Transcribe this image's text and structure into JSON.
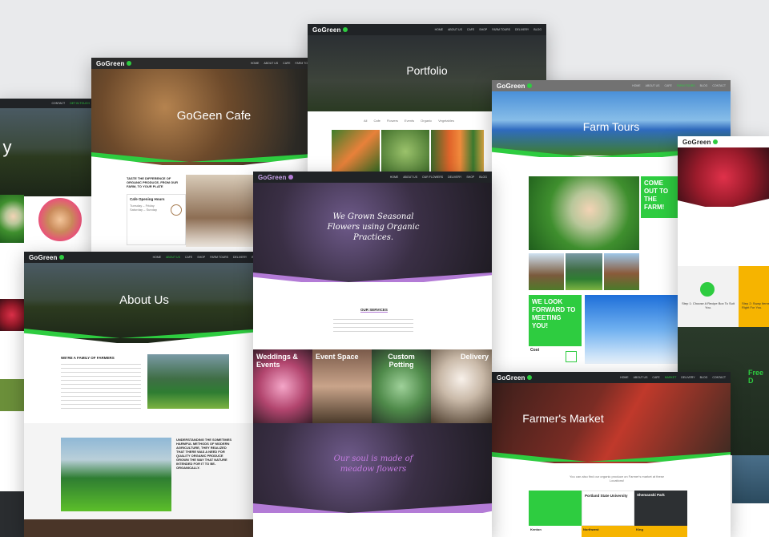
{
  "cafe": {
    "logo": "GoGreen",
    "title": "GoGeen Cafe",
    "tagline": "TASTE THE DIFFERENCE OF ORGANIC PRODUCE, FROM OUR FARM, TO YOUR PLATE",
    "hours_title": "Cafe Opening Hours"
  },
  "portfolio": {
    "logo": "GoGreen",
    "title": "Portfolio",
    "filters": [
      "All",
      "Cafe",
      "Flowers",
      "Events",
      "Organic",
      "Vegetables"
    ]
  },
  "tours": {
    "logo": "GoGreen",
    "title": "Farm Tours",
    "come_out": "COME OUT TO THE FARM!",
    "look_forward": "WE LOOK FORWARD TO MEETING YOU!",
    "cost_label": "Cost"
  },
  "about": {
    "logo": "GoGreen",
    "title": "About Us",
    "family_heading": "WE'RE A FAMILY OF FARMERS",
    "quote": "UNDERSTANDING THE SOMETIMES HARMFUL METHODS OF MODERN AGRICULTURE, THEY REALIZED THAT THERE WAS A NEED FOR QUALITY ORGANIC PRODUCE GROWN THE WAY THAT NATURE INTENDED FOR IT TO BE- ORGANICALLY."
  },
  "flowers": {
    "logo": "GoGreen",
    "hero": "We Grown Seasonal Flowers using Organic Practices.",
    "services_label": "OUR SERVICES",
    "tiles": [
      "Weddings & Events",
      "Event Space",
      "Custom Potting",
      "Delivery"
    ],
    "soul": "Our soul is made of meadow flowers"
  },
  "market": {
    "logo": "GoGreen",
    "title": "Farmer's Market",
    "intro": "You can also find our organic produce on Farmer's market at these Locations!",
    "locations": [
      "Portland State University",
      "Shemanski Park",
      "Northwest",
      "King",
      "Kenton"
    ]
  },
  "delivery": {
    "logo": "GoGreen",
    "step1": "Step 1: Choose A Recipe Box To Suit You.",
    "step2": "Step 2: Swap Items If The Time Is Right For You.",
    "free": "Free D"
  },
  "left": {
    "logo": "GoGreen",
    "partial": "y"
  }
}
